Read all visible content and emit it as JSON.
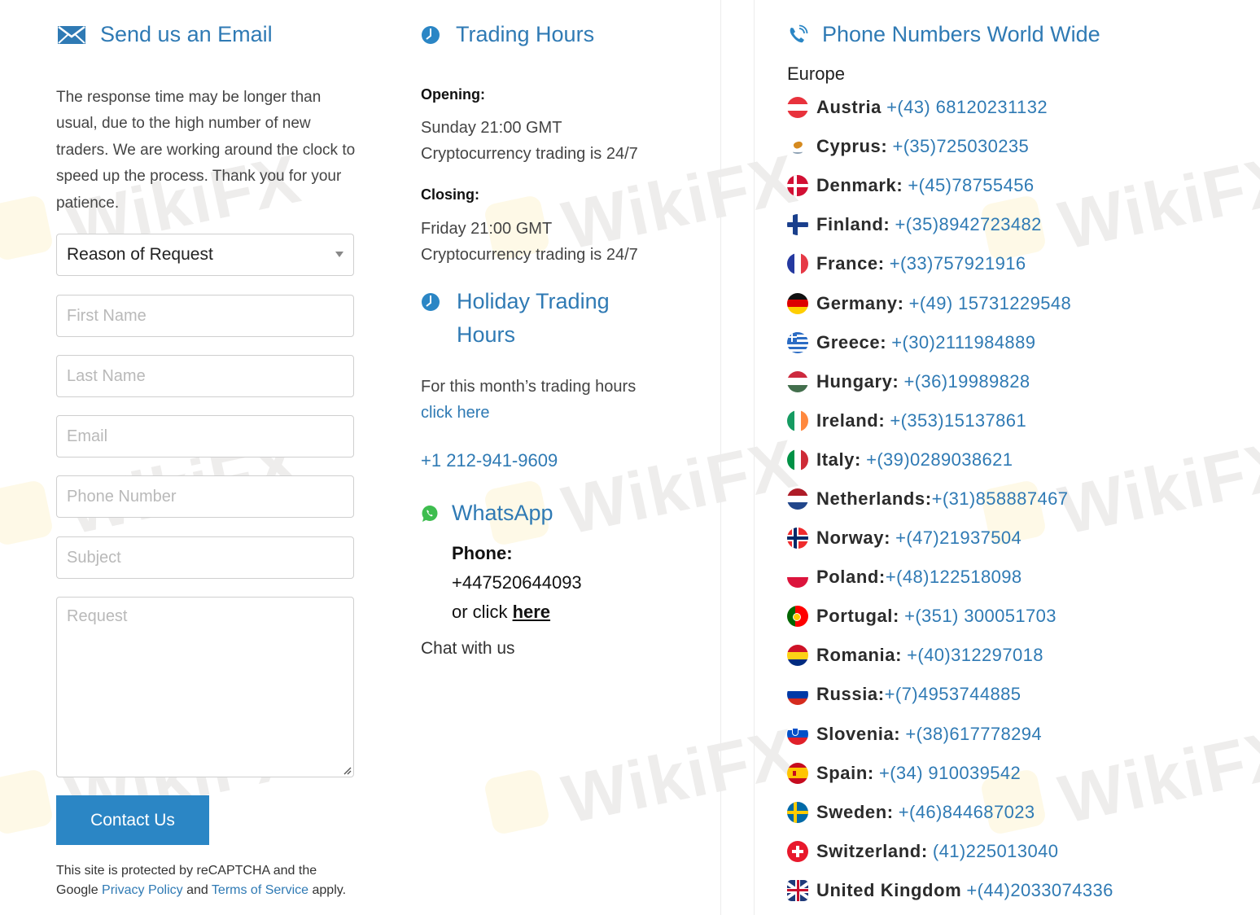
{
  "email_section": {
    "title": "Send us an Email",
    "icon": "envelope-icon",
    "intro": "The response time may be longer than usual, due to the high number of new traders. We are working around the clock to speed up the process. Thank you for your patience.",
    "reason_select": {
      "value": "Reason of Request"
    },
    "fields": {
      "first_name": {
        "placeholder": "First Name",
        "value": ""
      },
      "last_name": {
        "placeholder": "Last Name",
        "value": ""
      },
      "email": {
        "placeholder": "Email",
        "value": ""
      },
      "phone": {
        "placeholder": "Phone Number",
        "value": ""
      },
      "subject": {
        "placeholder": "Subject",
        "value": ""
      },
      "request": {
        "placeholder": "Request",
        "value": ""
      }
    },
    "submit_label": "Contact Us",
    "recaptcha": {
      "line1": "This site is protected by reCAPTCHA and the",
      "google": "Google ",
      "privacy_link": "Privacy Policy",
      "and": " and ",
      "terms_link": "Terms of Service",
      "apply": " apply."
    }
  },
  "trading_hours": {
    "title": "Trading Hours",
    "icon": "clock-icon",
    "opening_label": "Opening:",
    "opening_time": "Sunday 21:00 GMT",
    "opening_note": "Cryptocurrency trading is 24/7",
    "closing_label": "Closing:",
    "closing_time": "Friday 21:00 GMT",
    "closing_note": "Cryptocurrency trading is 24/7"
  },
  "holiday_hours": {
    "title": "Holiday Trading Hours",
    "icon": "clock-icon",
    "text": "For this month’s trading hours",
    "link": "click here",
    "phone": "+1 212-941-9609"
  },
  "whatsapp": {
    "title": "WhatsApp",
    "icon": "whatsapp-icon",
    "phone_label": "Phone:",
    "phone": "+447520644093",
    "or_click": "or click ",
    "here_link": "here",
    "chat": "Chat with us"
  },
  "phone_numbers": {
    "title": "Phone Numbers World Wide",
    "icon": "phone-icon",
    "region": "Europe",
    "items": [
      {
        "country": "Austria",
        "sep": " ",
        "number": "+(43) 68120231132",
        "flag": "austria"
      },
      {
        "country": "Cyprus:",
        "sep": " ",
        "number": "+(35)725030235",
        "flag": "cyprus"
      },
      {
        "country": "Denmark:",
        "sep": " ",
        "number": "+(45)78755456",
        "flag": "denmark"
      },
      {
        "country": "Finland:",
        "sep": " ",
        "number": "+(35)8942723482",
        "flag": "finland"
      },
      {
        "country": "France:",
        "sep": " ",
        "number": "+(33)757921916",
        "flag": "france"
      },
      {
        "country": "Germany:",
        "sep": " ",
        "number": "+(49) 15731229548",
        "flag": "germany"
      },
      {
        "country": "Greece:",
        "sep": " ",
        "number": "+(30)2111984889",
        "flag": "greece"
      },
      {
        "country": "Hungary:",
        "sep": " ",
        "number": "+(36)19989828",
        "flag": "hungary"
      },
      {
        "country": "Ireland:",
        "sep": " ",
        "number": "+(353)15137861",
        "flag": "ireland"
      },
      {
        "country": "Italy:",
        "sep": " ",
        "number": "+(39)0289038621",
        "flag": "italy"
      },
      {
        "country": "Netherlands:",
        "sep": "",
        "number": "+(31)858887467",
        "flag": "netherlands"
      },
      {
        "country": "Norway:",
        "sep": " ",
        "number": "+(47)21937504",
        "flag": "norway"
      },
      {
        "country": "Poland:",
        "sep": "",
        "number": "+(48)122518098",
        "flag": "poland"
      },
      {
        "country": "Portugal:",
        "sep": " ",
        "number": "+(351) 300051703",
        "flag": "portugal"
      },
      {
        "country": "Romania:",
        "sep": " ",
        "number": "+(40)312297018",
        "flag": "romania"
      },
      {
        "country": "Russia:",
        "sep": "",
        "number": "+(7)4953744885",
        "flag": "russia"
      },
      {
        "country": "Slovenia:",
        "sep": " ",
        "number": "+(38)617778294",
        "flag": "slovenia"
      },
      {
        "country": "Spain:",
        "sep": " ",
        "number": "+(34) 910039542",
        "flag": "spain"
      },
      {
        "country": "Sweden:",
        "sep": " ",
        "number": "+(46)844687023",
        "flag": "sweden"
      },
      {
        "country": "Switzerland:",
        "sep": " ",
        "number": "(41)225013040",
        "flag": "switzerland"
      },
      {
        "country": "United Kingdom",
        "sep": " ",
        "number": "+(44)2033074336",
        "flag": "united-kingdom"
      }
    ]
  },
  "watermark": "WikiFX",
  "colors": {
    "accent": "#2f7ab4",
    "button": "#2b86c5",
    "whatsapp": "#3ebd4f"
  }
}
